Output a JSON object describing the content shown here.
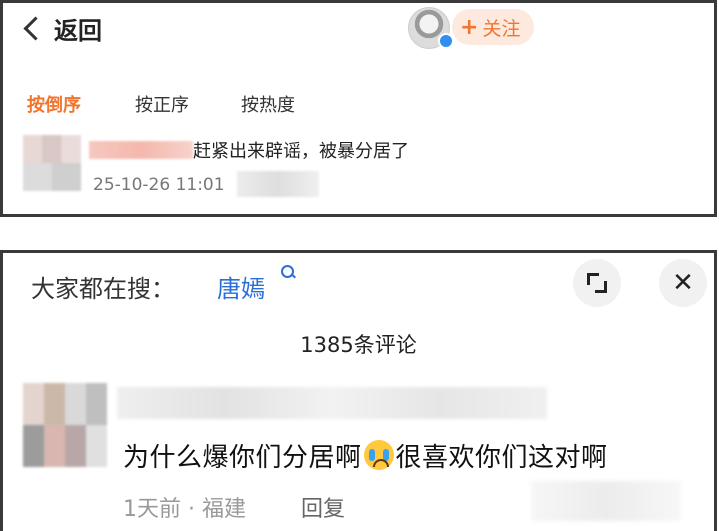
{
  "top_panel": {
    "back_label": "返回",
    "follow_label": "关注",
    "follow_plus": "+",
    "sort_tabs": [
      {
        "label": "按倒序",
        "active": true
      },
      {
        "label": "按正序",
        "active": false
      },
      {
        "label": "按热度",
        "active": false
      }
    ],
    "comment": {
      "text": "赶紧出来辟谣，被暴分居了",
      "timestamp": "25-10-26 11:01"
    },
    "accent_color": "#f0752e"
  },
  "bottom_panel": {
    "search_prefix": "大家都在搜：",
    "search_term": "唐嫣",
    "comment_count": "1385条评论",
    "comment": {
      "text_part1": "为什么爆你们分居啊",
      "emoji": "crying-face",
      "text_part2": "很喜欢你们这对啊",
      "meta": "1天前 · 福建",
      "reply_label": "回复"
    },
    "link_color": "#2a6fd6"
  }
}
